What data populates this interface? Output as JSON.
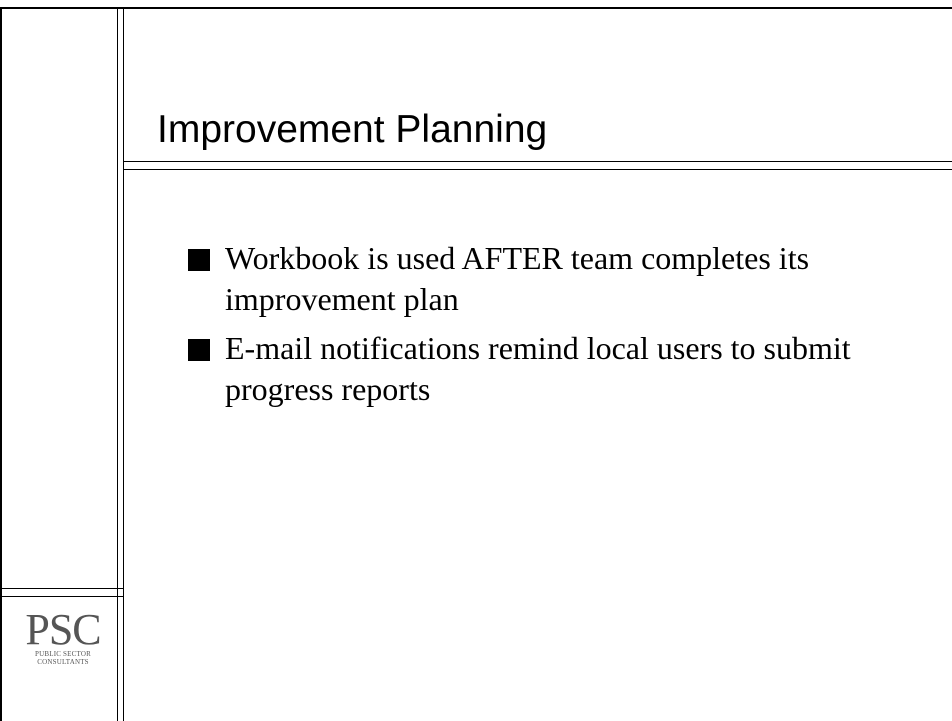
{
  "slide": {
    "title": "Improvement Planning",
    "bullets": [
      "Workbook is used AFTER team completes its improvement plan",
      "E-mail notifications remind local users to submit progress reports"
    ]
  },
  "logo": {
    "main": "PSC",
    "sub_line1": "PUBLIC SECTOR",
    "sub_line2": "CONSULTANTS"
  }
}
